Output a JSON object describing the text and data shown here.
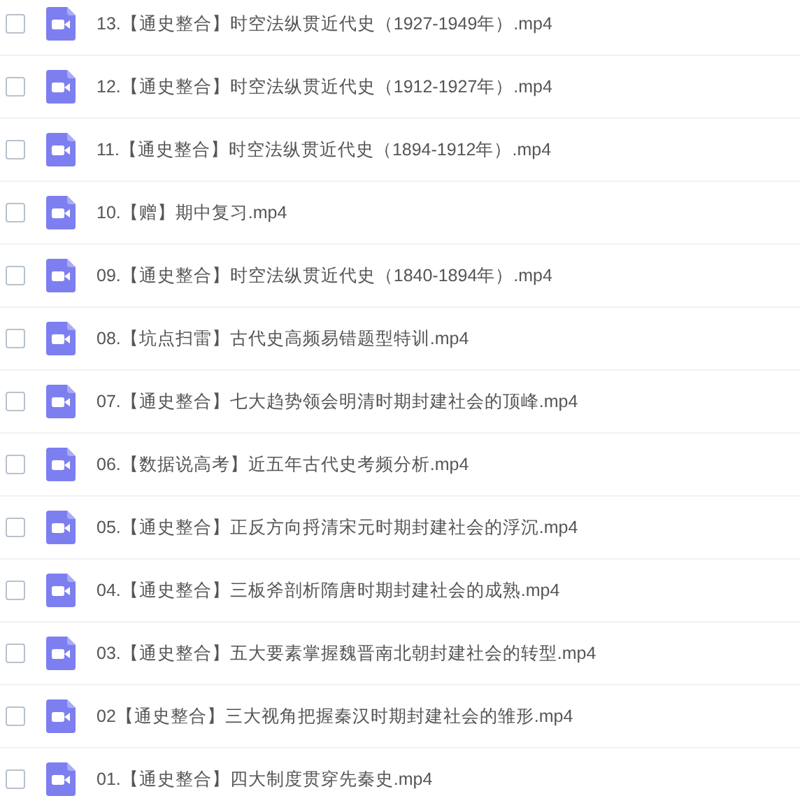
{
  "files": [
    {
      "name": "13.【通史整合】时空法纵贯近代史（1927-1949年）.mp4",
      "checked": false
    },
    {
      "name": "12.【通史整合】时空法纵贯近代史（1912-1927年）.mp4",
      "checked": false
    },
    {
      "name": "11.【通史整合】时空法纵贯近代史（1894-1912年）.mp4",
      "checked": false
    },
    {
      "name": "10.【赠】期中复习.mp4",
      "checked": false
    },
    {
      "name": "09.【通史整合】时空法纵贯近代史（1840-1894年）.mp4",
      "checked": false
    },
    {
      "name": "08.【坑点扫雷】古代史高频易错题型特训.mp4",
      "checked": false
    },
    {
      "name": "07.【通史整合】七大趋势领会明清时期封建社会的顶峰.mp4",
      "checked": false
    },
    {
      "name": "06.【数据说高考】近五年古代史考频分析.mp4",
      "checked": false
    },
    {
      "name": "05.【通史整合】正反方向捋清宋元时期封建社会的浮沉.mp4",
      "checked": false
    },
    {
      "name": "04.【通史整合】三板斧剖析隋唐时期封建社会的成熟.mp4",
      "checked": false
    },
    {
      "name": "03.【通史整合】五大要素掌握魏晋南北朝封建社会的转型.mp4",
      "checked": false
    },
    {
      "name": "02【通史整合】三大视角把握秦汉时期封建社会的雏形.mp4",
      "checked": false
    },
    {
      "name": "01.【通史整合】四大制度贯穿先秦史.mp4",
      "checked": false
    }
  ]
}
